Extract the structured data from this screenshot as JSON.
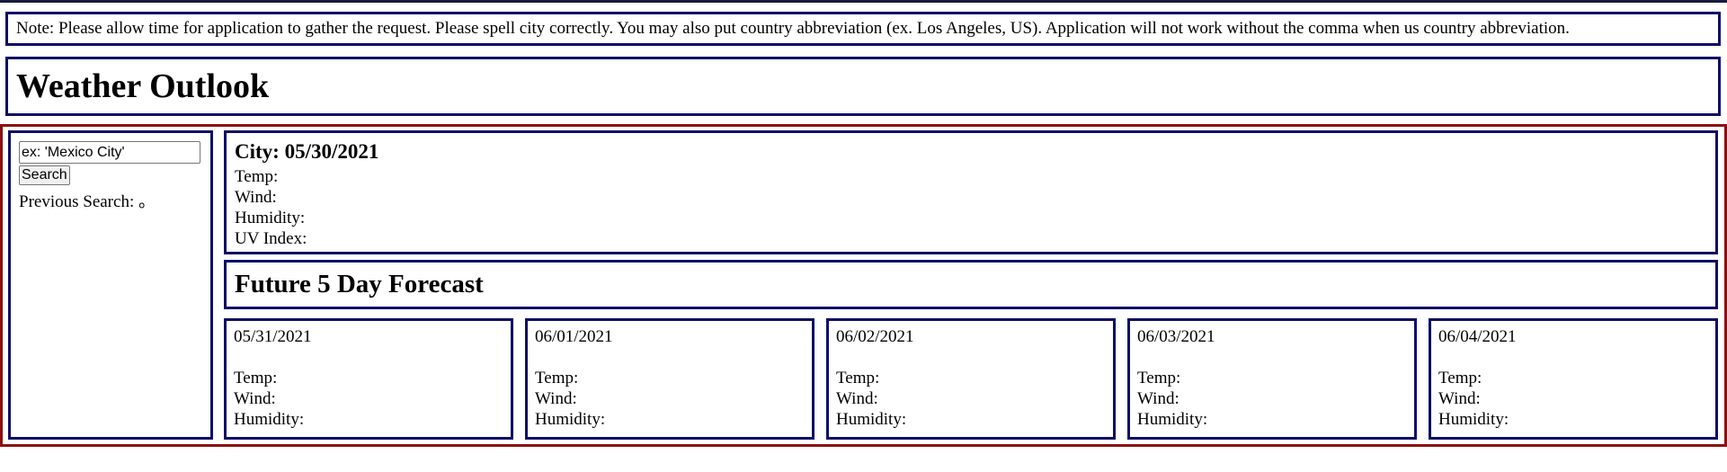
{
  "note": "Note: Please allow time for application to gather the request. Please spell city correctly. You may also put country abbreviation (ex. Los Angeles, US). Application will not work without the comma when us country abbreviation.",
  "header": {
    "title": "Weather Outlook"
  },
  "sidebar": {
    "search_value": "ex: 'Mexico City'",
    "search_button": "Search",
    "previous_search": "Previous Search: 。"
  },
  "current": {
    "city_date": "City: 05/30/2021",
    "temp": "Temp:",
    "wind": "Wind:",
    "humidity": "Humidity:",
    "uv": "UV Index:"
  },
  "forecast_title": "Future 5 Day Forecast",
  "forecast": [
    {
      "date": "05/31/2021",
      "temp": "Temp:",
      "wind": "Wind:",
      "humidity": "Humidity:"
    },
    {
      "date": "06/01/2021",
      "temp": "Temp:",
      "wind": "Wind:",
      "humidity": "Humidity:"
    },
    {
      "date": "06/02/2021",
      "temp": "Temp:",
      "wind": "Wind:",
      "humidity": "Humidity:"
    },
    {
      "date": "06/03/2021",
      "temp": "Temp:",
      "wind": "Wind:",
      "humidity": "Humidity:"
    },
    {
      "date": "06/04/2021",
      "temp": "Temp:",
      "wind": "Wind:",
      "humidity": "Humidity:"
    }
  ],
  "colors": {
    "panel_border": "#0d0d66",
    "main_border": "#8b1010"
  }
}
